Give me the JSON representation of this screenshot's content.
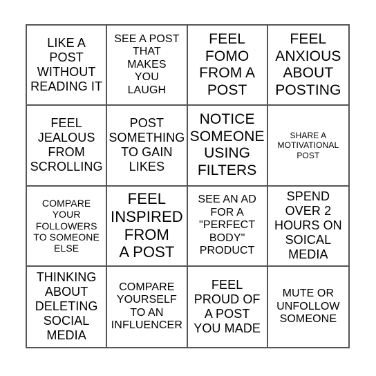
{
  "card": {
    "type": "bingo-card",
    "grid": {
      "columns": 4,
      "rows": 4
    },
    "colors": {
      "border": "#555555",
      "cell_background": "#ffffff",
      "text": "#000000",
      "page_background": "#ffffff"
    },
    "cells": [
      {
        "position": "r1c1",
        "text": "LIKE A\nPOST\nWITHOUT\nREADING IT"
      },
      {
        "position": "r1c2",
        "text": "SEE A POST\nTHAT\nMAKES\nYOU\nLAUGH"
      },
      {
        "position": "r1c3",
        "text": "FEEL\nFOMO\nFROM A\nPOST"
      },
      {
        "position": "r1c4",
        "text": "FEEL\nANXIOUS\nABOUT\nPOSTING"
      },
      {
        "position": "r2c1",
        "text": "FEEL\nJEALOUS\nFROM\nSCROLLING"
      },
      {
        "position": "r2c2",
        "text": "POST\nSOMETHING\nTO GAIN\nLIKES"
      },
      {
        "position": "r2c3",
        "text": "NOTICE\nSOMEONE\nUSING\nFILTERS"
      },
      {
        "position": "r2c4",
        "text": "SHARE A\nMOTIVATIONAL\nPOST"
      },
      {
        "position": "r3c1",
        "text": "COMPARE\nYOUR\nFOLLOWERS\nTO SOMEONE\nELSE"
      },
      {
        "position": "r3c2",
        "text": "FEEL\nINSPIRED\nFROM\nA POST"
      },
      {
        "position": "r3c3",
        "text": "SEE AN AD\nFOR A\n\"PERFECT\nBODY\"\nPRODUCT"
      },
      {
        "position": "r3c4",
        "text": "SPEND\nOVER 2\nHOURS ON\nSOICAL\nMEDIA"
      },
      {
        "position": "r4c1",
        "text": "THINKING\nABOUT\nDELETING\nSOCIAL\nMEDIA"
      },
      {
        "position": "r4c2",
        "text": "COMPARE\nYOURSELF\nTO AN\nINFLUENCER"
      },
      {
        "position": "r4c3",
        "text": "FEEL\nPROUD OF\nA POST\nYOU MADE"
      },
      {
        "position": "r4c4",
        "text": "MUTE OR\nUNFOLLOW\nSOMEONE"
      }
    ]
  }
}
